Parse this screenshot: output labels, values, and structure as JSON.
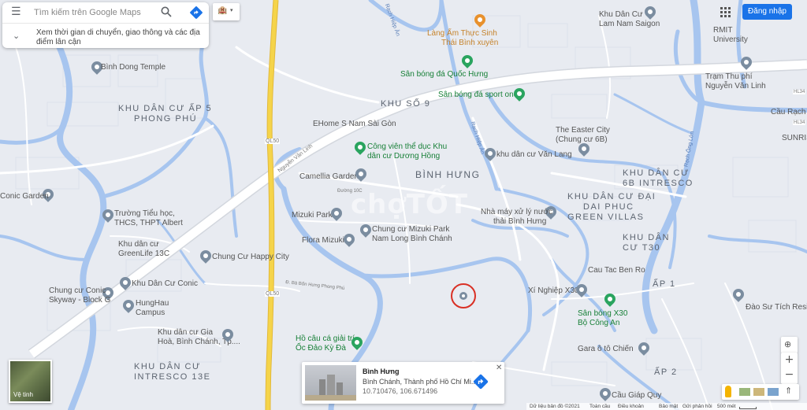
{
  "search": {
    "placeholder": "Tìm kiếm trên Google Maps",
    "transit_note": "Xem thời gian di chuyển, giao thông và các địa điểm lân cận"
  },
  "top_right": {
    "signin_label": "Đăng nhập"
  },
  "areas": {
    "ap5": [
      "KHU DÂN CƯ ẤP 5",
      "PHONG PHÚ"
    ],
    "khuso9": "KHU SỐ 9",
    "binhhung": "BÌNH HƯNG",
    "intresco6b": [
      "KHU DÂN CƯ",
      "6B INTRESCO"
    ],
    "daiphuc": [
      "KHU DÂN CƯ ĐẠI",
      "DAI PHUC",
      "GREEN VILLAS"
    ],
    "t30": [
      "KHU DÂN",
      "CƯ T30"
    ],
    "ap1": "ẤP 1",
    "ap2": "ẤP 2",
    "intresco13e": [
      "KHU DÂN CƯ",
      "INTRESCO 13E"
    ]
  },
  "pois": {
    "ehome": "EHome S Nam Sài Gòn",
    "cong_vien": [
      "Công viên thể dục Khu",
      "dân cư Dương Hồng"
    ],
    "camellia": "Camellia Garden",
    "mizuki_park": "Mizuki Park",
    "flora": "Flora Mizuki",
    "chung_cu_mizuki": [
      "Chung cư Mizuki Park",
      "Nam Long Bình Chánh"
    ],
    "happy_city": "Chung Cư Happy City",
    "conic_garden": "Conic Garden",
    "truong": [
      "Trường Tiểu học,",
      "THCS, THPT Albert"
    ],
    "greenlife": [
      "Khu dân cư",
      "GreenLife 13C"
    ],
    "conic_skyway": [
      "Chung cư Conic",
      "Skyway - Block G"
    ],
    "conic": "Khu Dân Cư Conic",
    "hunghau": [
      "HungHau",
      "Campus"
    ],
    "gia_hoa": [
      "Khu dân cư Gia",
      "Hoà, Bình Chánh, Tp...."
    ],
    "ho_cau": [
      "Hồ câu cá giải trí",
      "Ốc Đảo Kỳ Đà"
    ],
    "binh_dong_temple": "Bình Dong Temple",
    "lang_am_thuc": [
      "Làng Ẩm Thực Sinh",
      "Thái Bình xuyên"
    ],
    "san_bong_qh": "Sân bóng đá Quốc Hưng",
    "san_bong_sport": "Sân bóng đá sport one",
    "easter_city": [
      "The Easter City",
      "(Chung cư 6B)"
    ],
    "van_lang": "khu dân cư Văn Lang",
    "nha_may": [
      "Nhà máy xử lý nước",
      "thải Bình Hưng"
    ],
    "cau_tac": "Cau Tac Ben Ro",
    "xi_nghiep": "Xí Nghiệp X30",
    "san_bong_x30": [
      "Sân bóng X30",
      "Bộ Công An"
    ],
    "gara": "Gara ô tô Chiến",
    "cau_giap_quy": "Cầu Giáp Quy",
    "dao_su_tich": "Đào Sư Tích Residence",
    "rmit": [
      "RMIT",
      "University"
    ],
    "tram_thu_phi": [
      "Trạm Thu phí",
      "Nguyễn Văn Linh"
    ],
    "khu_dan_cu_lam": [
      "Khu Dân Cư",
      "Lam Nam Saigon"
    ],
    "cau_rach": "Cầu Rạch Đ",
    "sunrise": "SUNRIS"
  },
  "roads": {
    "nguyen_van_linh": "Nguyễn Văn Linh",
    "ql50a": "QL50",
    "ql50b": "QL50",
    "rach_hiep_an": "Rạch Hiệp Ân",
    "rach_ong_lon": "Rạch Ông Lớn",
    "duong_10c": "Đường 10C",
    "dt_dai": "Đ. Bà Bốn Hưng Phong Phú",
    "hl34": "HL34",
    "hl34b": "HL34"
  },
  "card": {
    "title": "Bình Hưng",
    "subtitle": "Bình Chánh, Thành phố Hồ Chí Mi...",
    "coords": "10.710476, 106.671496"
  },
  "satellite_label": "Vệ tinh",
  "footer": {
    "data": "Dữ liệu bản đồ ©2021",
    "terms": "Toàn cầu",
    "policy": "Điều khoản",
    "privacy": "Bảo mật",
    "feedback": "Gửi phản hồi",
    "scale": "500 mét"
  },
  "watermark": "chợTỐT",
  "colors": {
    "water": "#a7c5ef",
    "road": "#ffffff",
    "highway": "#f5d44a",
    "land": "#e8ebf1",
    "accent": "#1a73e8"
  }
}
